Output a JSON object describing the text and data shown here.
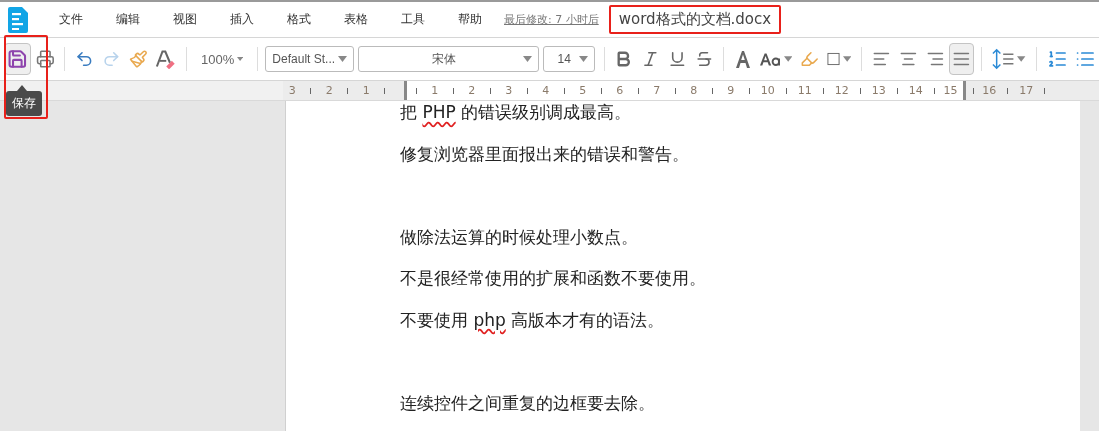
{
  "menu": {
    "items": [
      "文件",
      "编辑",
      "视图",
      "插入",
      "格式",
      "表格",
      "工具",
      "帮助"
    ],
    "last_modified": "最后修改: 7 小时后",
    "document_title": "word格式的文档.docx"
  },
  "toolbar": {
    "save_active": true,
    "tooltip": "保存",
    "zoom": "100%",
    "paragraph_style": "Default St...",
    "font": "宋体",
    "font_size": "14",
    "alignment": [
      {
        "selected": false
      },
      {
        "selected": false
      },
      {
        "selected": false
      },
      {
        "selected": true
      }
    ]
  },
  "ruler": {
    "left_labels": [
      "3",
      "2",
      "1"
    ],
    "right_labels": [
      "1",
      "2",
      "3",
      "4",
      "5",
      "6",
      "7",
      "8",
      "9",
      "10",
      "11",
      "12",
      "13",
      "14",
      "15",
      "16",
      "17"
    ]
  },
  "document": {
    "paragraphs": [
      {
        "kind": "text",
        "segments": [
          {
            "text": "把 ",
            "misspelled": false
          },
          {
            "text": "PHP",
            "misspelled": true
          },
          {
            "text": " 的错误级别调成最高。",
            "misspelled": false
          }
        ]
      },
      {
        "kind": "text",
        "segments": [
          {
            "text": "修复浏览器里面报出来的错误和警告。",
            "misspelled": false
          }
        ]
      },
      {
        "kind": "blank"
      },
      {
        "kind": "text",
        "segments": [
          {
            "text": "做除法运算的时候处理小数点。",
            "misspelled": false
          }
        ]
      },
      {
        "kind": "text",
        "segments": [
          {
            "text": "不是很经常使用的扩展和函数不要使用。",
            "misspelled": false
          }
        ]
      },
      {
        "kind": "text",
        "segments": [
          {
            "text": "不要使用 ",
            "misspelled": false
          },
          {
            "text": "php",
            "misspelled": true
          },
          {
            "text": " 高版本才有的语法。",
            "misspelled": false
          }
        ]
      },
      {
        "kind": "blank"
      },
      {
        "kind": "text",
        "segments": [
          {
            "text": "连续控件之间重复的边框要去除。",
            "misspelled": false
          }
        ]
      }
    ]
  }
}
